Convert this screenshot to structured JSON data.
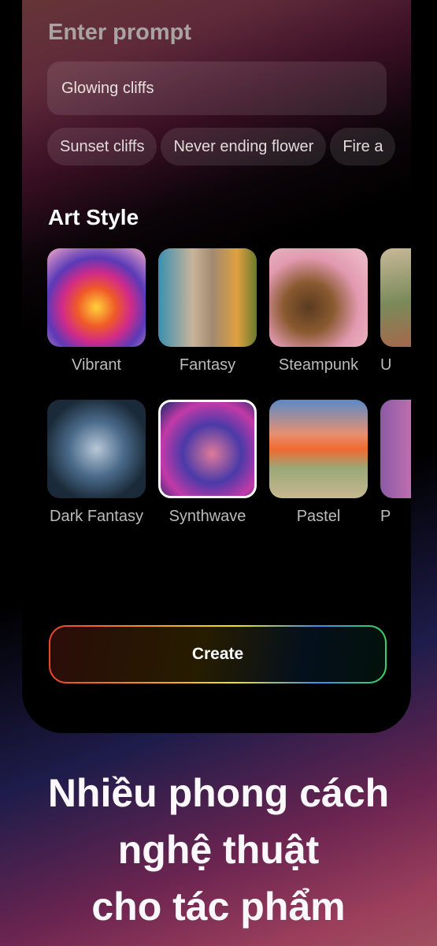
{
  "prompt": {
    "title": "Enter prompt",
    "value": "Glowing cliffs",
    "suggestions": [
      "Sunset cliffs",
      "Never ending flower",
      "Fire a"
    ]
  },
  "art_style": {
    "title": "Art Style",
    "selected": "Synthwave",
    "row1": [
      "Vibrant",
      "Fantasy",
      "Steampunk",
      "U"
    ],
    "row2": [
      "Dark Fantasy",
      "Synthwave",
      "Pastel",
      "P"
    ]
  },
  "create_label": "Create",
  "caption": [
    "Nhiều phong cách",
    "nghệ thuật",
    "cho tác phẩm"
  ]
}
